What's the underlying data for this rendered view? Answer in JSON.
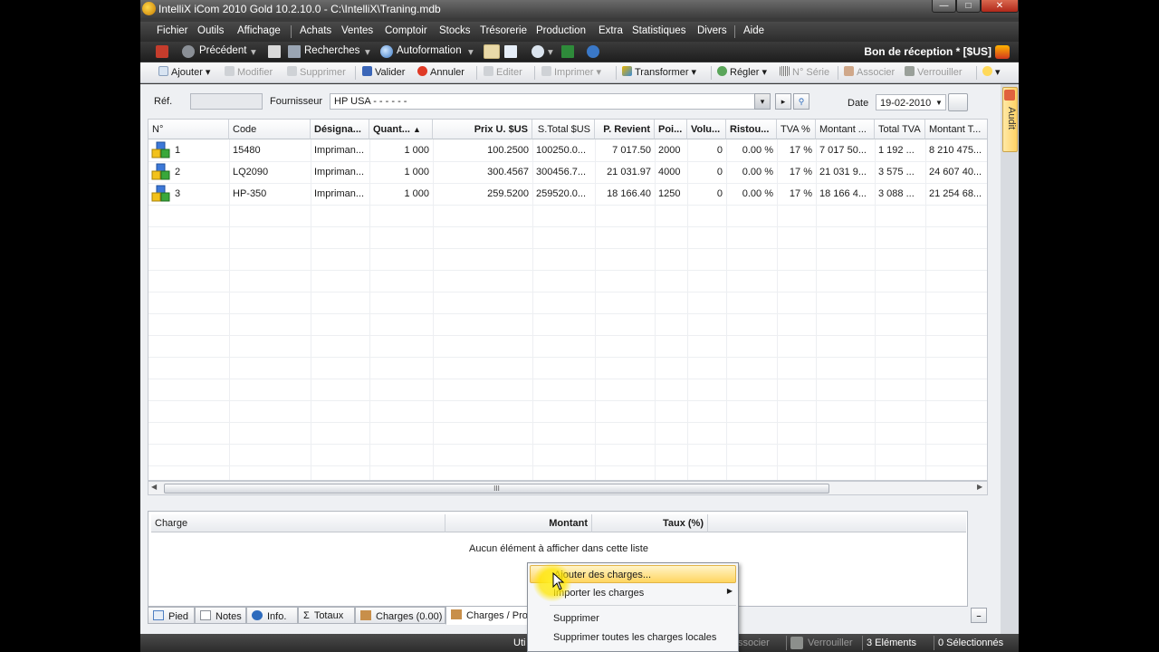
{
  "window": {
    "title": "IntelliX iCom 2010 Gold 10.2.10.0 - C:\\IntelliX\\Traning.mdb"
  },
  "menubar": [
    "Fichier",
    "Outils",
    "Affichage",
    "Achats",
    "Ventes",
    "Comptoir",
    "Stocks",
    "Trésorerie",
    "Production",
    "Extra",
    "Statistiques",
    "Divers",
    "Aide"
  ],
  "navbar": {
    "previous": "Précédent",
    "search": "Recherches",
    "autoformation": "Autoformation",
    "doc_title": "Bon de réception * [$US]"
  },
  "toolbar": {
    "ajouter": "Ajouter",
    "modifier": "Modifier",
    "supprimer": "Supprimer",
    "valider": "Valider",
    "annuler": "Annuler",
    "editer": "Editer",
    "imprimer": "Imprimer",
    "transformer": "Transformer",
    "regler": "Régler",
    "serie": "N° Série",
    "associer": "Associer",
    "verrouiller": "Verrouiller"
  },
  "form": {
    "ref_label": "Réf.",
    "ref_value": "",
    "supplier_label": "Fournisseur",
    "supplier_value": "HP USA  -  -  -  -  -  -",
    "date_label": "Date",
    "date_value": "19-02-2010"
  },
  "grid": {
    "columns": [
      "N°",
      "Code",
      "Désigna...",
      "Quant...",
      "Prix U. $US",
      "S.Total $US",
      "P. Revient",
      "Poi...",
      "Volu...",
      "Ristou...",
      "TVA %",
      "Montant ...",
      "Total TVA",
      "Montant T..."
    ],
    "rows": [
      [
        "1",
        "15480",
        "Impriman...",
        "1 000",
        "100.2500",
        "100250.0...",
        "7 017.50",
        "2000",
        "0",
        "0.00 %",
        "17 %",
        "7 017 50...",
        "1 192 ...",
        "8 210 475..."
      ],
      [
        "2",
        "LQ2090",
        "Impriman...",
        "1 000",
        "300.4567",
        "300456.7...",
        "21 031.97",
        "4000",
        "0",
        "0.00 %",
        "17 %",
        "21 031 9...",
        "3 575 ...",
        "24 607 40..."
      ],
      [
        "3",
        "HP-350",
        "Impriman...",
        "1 000",
        "259.5200",
        "259520.0...",
        "18 166.40",
        "1250",
        "0",
        "0.00 %",
        "17 %",
        "18 166 4...",
        "3 088 ...",
        "21 254 68..."
      ]
    ],
    "scroll_thumb": "III"
  },
  "charges": {
    "columns": [
      "Charge",
      "Montant",
      "Taux (%)"
    ],
    "empty_text": "Aucun élément à afficher dans cette liste"
  },
  "bottom_tabs": [
    "Pied",
    "Notes",
    "Info.",
    "Totaux",
    "Charges (0.00)",
    "Charges / Pro"
  ],
  "context_menu": {
    "items": [
      "Ajouter des charges...",
      "Importer les charges",
      "Supprimer",
      "Supprimer toutes les charges locales"
    ]
  },
  "statusbar": {
    "left_partial": "Uti",
    "associer": "ssocier",
    "verrouiller": "Verrouiller",
    "elements": "3 Eléments",
    "selected": "0 Sélectionnés"
  },
  "side_tab": "Audit",
  "colors": {
    "accent": "#ffd560",
    "window_chrome": "#3a3a3a",
    "grid_bg": "#ffffff"
  },
  "icons": [
    "app-icon",
    "back-icon",
    "search-icon",
    "globe-icon",
    "add-icon",
    "save-icon",
    "cancel-icon",
    "print-icon",
    "transform-icon",
    "settle-icon",
    "lock-icon",
    "help-icon",
    "item-cubes-icon"
  ]
}
